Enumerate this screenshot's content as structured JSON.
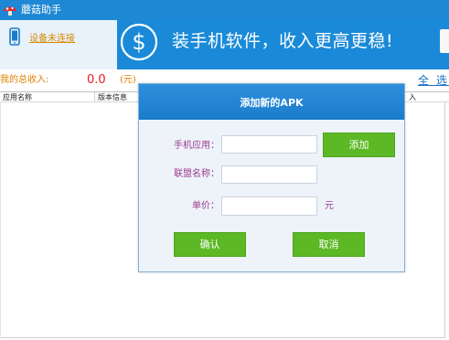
{
  "app": {
    "title": "蘑菇助手"
  },
  "device": {
    "status": "设备未连接"
  },
  "banner": {
    "text": "装手机软件，收入更高更稳!"
  },
  "income": {
    "label": "我的总收入:",
    "value": "0.0",
    "unit": "(元)"
  },
  "select_all": "全 选",
  "table": {
    "columns": [
      "应用名称",
      "版本信息",
      "入"
    ]
  },
  "dialog": {
    "title": "添加新的APK",
    "app_label": "手机应用：",
    "app_value": "",
    "add_button": "添加",
    "alliance_label": "联盟名称：",
    "alliance_value": "",
    "price_label": "单价：",
    "price_value": "",
    "price_unit": "元",
    "confirm_button": "确认",
    "cancel_button": "取消"
  },
  "colors": {
    "titlebar": "#1e88d4",
    "banner": "#1a8ad8",
    "button_green": "#5cb824",
    "income_orange": "#e08000",
    "income_value_red": "#e51c1c",
    "label_purple": "#9b3b92"
  },
  "icons": [
    "mushroom-logo-icon",
    "phone-icon",
    "dollar-coin-icon"
  ]
}
